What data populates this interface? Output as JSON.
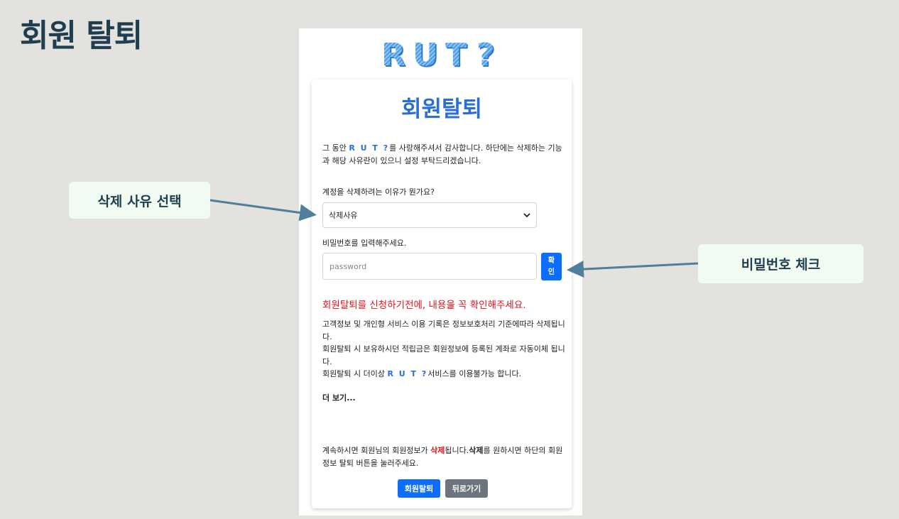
{
  "slide": {
    "title": "회원 탈퇴"
  },
  "logo": {
    "text": "RUT?"
  },
  "card": {
    "title": "회원탈퇴",
    "intro_pre": "그 동안 ",
    "brand": "R U T ?",
    "intro_post": "를 사랑해주셔서 감사합니다. 하단에는 삭제하는 기능과 해당 사유란이 있으니 설정 부탁드리겠습니다.",
    "reason_label": "계정을 삭제하려는 이유가 뭔가요?",
    "reason_selected": "삭제사유",
    "password_label": "비밀번호를 입력해주세요.",
    "password_placeholder": "password",
    "confirm_line1": "확",
    "confirm_line2": "인",
    "warning_heading": "회원탈퇴를 신청하기전에, 내용을 꼭 확인해주세요.",
    "notice1": "고객정보 및 개인형 서비스 이용 기록은 정보보호처리 기준에따라 삭제됩니다.",
    "notice2": "회원탈퇴 시 보유하시던 적립금은 회원정보에 등록된 계좌로 자동이체 됩니다.",
    "notice3_pre": "회원탈퇴 시 더이상 ",
    "notice3_brand": "R U T ?",
    "notice3_post": "서비스를 이용불가능 합니다.",
    "more_link": "더 보기...",
    "bottom_pre": "계속하시면 회원님의 회원정보가 ",
    "bottom_red": "삭제",
    "bottom_mid": "됩니다.",
    "bottom_bold": "삭제",
    "bottom_post": "를 원하시면 하단의 회원정보 탈퇴 버튼을 눌러주세요.",
    "withdraw_button": "회원탈퇴",
    "back_button": "뒤로가기"
  },
  "callouts": {
    "left": "삭제 사유 선택",
    "right": "비밀번호 체크"
  },
  "colors": {
    "accent": "#2b6fd6",
    "primary_button": "#0d6efd",
    "secondary_button": "#6c757d",
    "warning": "#e0141e",
    "arrow": "#4f7f9a"
  }
}
